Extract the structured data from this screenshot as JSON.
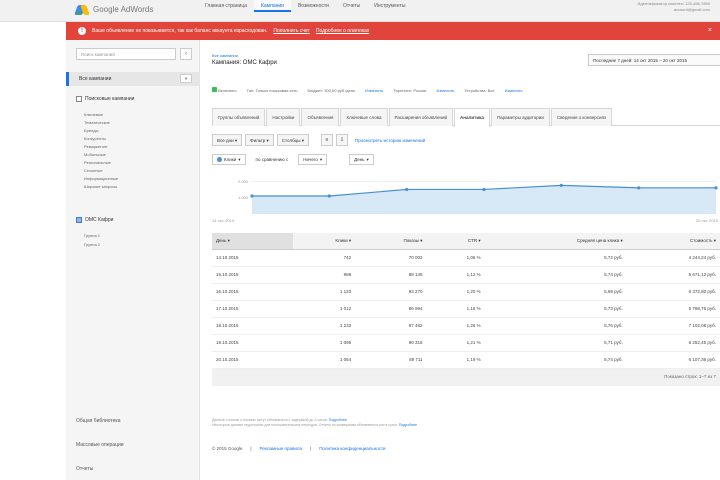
{
  "app": {
    "logo_text": "Google AdWords",
    "nav": [
      "Главная страница",
      "Кампании",
      "Возможности",
      "Отчеты",
      "Инструменты"
    ],
    "account_line1": "Идентификатор клиента: 123-456-7890",
    "account_line2": "account@gmail.com"
  },
  "alert": {
    "text": "Ваше объявление не показывается, так как баланс аккаунта израсходован.",
    "link1": "Пополнить счет",
    "link2": "Подробнее о платежах",
    "close": "×"
  },
  "sidebar": {
    "search_placeholder": "Поиск кампаний",
    "all_label": "Все кампании",
    "collapse": "«",
    "group1": "Поисковые кампании",
    "group1_items": [
      "Ключевые",
      "Тематические",
      "Бренды",
      "Конкуренты",
      "Ремаркетинг",
      "Мобильные",
      "Региональные",
      "Сезонные",
      "Информационные",
      "Широкие запросы"
    ],
    "group2": "ОМС Кафри",
    "group2_items": [
      "Группа 1",
      "Группа 2"
    ],
    "footer": [
      "Общая библиотека",
      "Массовые операции",
      "Отчеты"
    ]
  },
  "main": {
    "breadcrumb": "Все кампании",
    "title": "Кампания: ОМС Кафри",
    "date_range": "Последние 7 дней: 14 окт 2015 – 20 окт 2015",
    "status": {
      "state": "Включено",
      "type": "Тип: Только поисковая сеть",
      "budget": "Бюджет: 300,00 руб./день",
      "edit1": "Изменить",
      "targeting": "Таргетинг: Россия",
      "edit2": "Изменить",
      "devices": "Устройства: Все",
      "edit3": "Изменить"
    },
    "tabs": [
      "Группы объявлений",
      "Настройки",
      "Объявления",
      "Ключевые слова",
      "Расширения объявлений",
      "Аналитика",
      "Параметры аудитории",
      "Сведения о конверсиях"
    ],
    "toolbar": {
      "btn1": "Все дни",
      "btn2": "Фильтр",
      "btn3": "Столбцы",
      "icon1": "≡",
      "icon2": "⇩",
      "link": "Просмотреть историю изменений"
    },
    "metrics": {
      "m1": "Клики",
      "vs": "по сравнению с",
      "m2": "Ничего",
      "m3": "День"
    }
  },
  "chart_data": {
    "type": "area",
    "x": [
      "14 окт",
      "15 окт",
      "16 окт",
      "17 окт",
      "18 окт",
      "19 окт",
      "20 окт"
    ],
    "values": [
      1100,
      1100,
      1500,
      1500,
      1750,
      1600,
      1600
    ],
    "ylim": [
      0,
      2200
    ],
    "ytick_labels": [
      "2 000",
      "1 000"
    ],
    "xlabel_left": "14 окт. 2015",
    "xlabel_right": "20 окт. 2015"
  },
  "table": {
    "headers": [
      "День",
      "Клики",
      "Показы",
      "CTR",
      "Средняя цена клика",
      "Стоимость"
    ],
    "rows": [
      [
        "14.10.2015",
        "742",
        "70 002",
        "1,06 %",
        "5,72 руб.",
        "4 244,24 руб."
      ],
      [
        "15.10.2015",
        "988",
        "88 145",
        "1,12 %",
        "5,74 руб.",
        "5 671,12 руб."
      ],
      [
        "16.10.2015",
        "1 120",
        "93 270",
        "1,20 %",
        "5,69 руб.",
        "6 372,80 руб."
      ],
      [
        "17.10.2015",
        "1 012",
        "86 994",
        "1,16 %",
        "5,73 руб.",
        "5 798,76 руб."
      ],
      [
        "18.10.2015",
        "1 233",
        "97 482",
        "1,26 %",
        "5,76 руб.",
        "7 102,08 руб."
      ],
      [
        "19.10.2015",
        "1 095",
        "90 318",
        "1,21 %",
        "5,71 руб.",
        "6 252,45 руб."
      ],
      [
        "20.10.2015",
        "1 064",
        "89 711",
        "1,19 %",
        "5,74 руб.",
        "6 107,36 руб."
      ]
    ],
    "total_label": "Показано строк: 1–7 из 7"
  },
  "footnote": {
    "text1": "Данные о кликах и показах могут обновляться с задержкой до 3 часов.",
    "link1": "Подробнее",
    "text2": "Некоторые данные недоступны для пользовательских периодов. Отчеты по конверсиям обновляются раз в сутки.",
    "link2": "Подробнее"
  },
  "footer": {
    "copyright": "© 2015 Google",
    "link1": "Рекламные правила",
    "link2": "Политика конфиденциальности"
  }
}
